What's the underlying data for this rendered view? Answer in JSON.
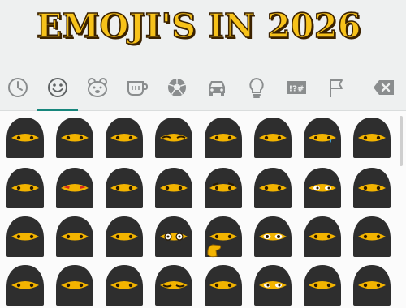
{
  "headline": {
    "text": "EMOJI'S IN 2026"
  },
  "categories": [
    {
      "name": "recent",
      "icon": "clock-icon"
    },
    {
      "name": "smileys",
      "icon": "smiley-icon",
      "active": true
    },
    {
      "name": "animals",
      "icon": "bear-icon"
    },
    {
      "name": "food",
      "icon": "cup-icon"
    },
    {
      "name": "activity",
      "icon": "soccer-ball-icon"
    },
    {
      "name": "travel",
      "icon": "car-icon"
    },
    {
      "name": "objects",
      "icon": "lightbulb-icon"
    },
    {
      "name": "symbols",
      "icon": "symbols-icon",
      "label": "!?#"
    },
    {
      "name": "flags",
      "icon": "flag-icon"
    },
    {
      "name": "delete",
      "icon": "backspace-icon"
    }
  ],
  "emoji_grid": {
    "rows": [
      [
        "plain",
        "plain",
        "plain",
        "side-glance",
        "plain",
        "plain",
        "tear",
        "plain"
      ],
      [
        "plain",
        "angry-red",
        "plain",
        "plain",
        "raised-brows",
        "plain",
        "white-eyes",
        "plain"
      ],
      [
        "plain",
        "plain",
        "plain",
        "glasses",
        "thinking-hand",
        "wide-eyes",
        "plain",
        "plain"
      ],
      [
        "plain",
        "plain",
        "plain",
        "squint",
        "plain",
        "white-eyes",
        "plain",
        "plain"
      ]
    ]
  },
  "colors": {
    "accent": "#17867c",
    "burqa": "#2e2e2e",
    "skin": "#f3b400",
    "headline_fill": "#f7c21a",
    "icon_gray": "#8a8d8e"
  }
}
